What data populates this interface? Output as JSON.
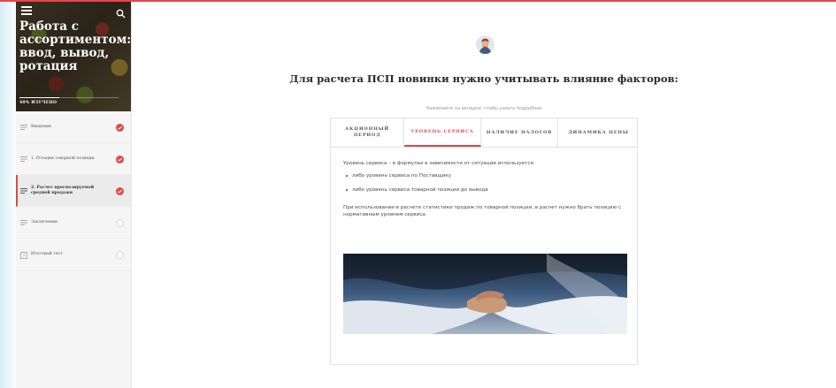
{
  "course": {
    "title": "Работа с ассортиментом: ввод, вывод, ротация",
    "progress_label": "40% ИЗУЧЕНО",
    "progress_value": 0.4
  },
  "sidebar": {
    "items": [
      {
        "label": "Введение",
        "icon": "lesson-lines-icon",
        "status": "done"
      },
      {
        "label": "1. Ротация товарной позиции",
        "icon": "lesson-lines-icon",
        "status": "done"
      },
      {
        "label": "2. Расчет прогнозируемой средней продажи",
        "icon": "lesson-lines-icon",
        "status": "done",
        "active": true
      },
      {
        "label": "Заключение",
        "icon": "lesson-lines-icon",
        "status": "todo"
      },
      {
        "label": "Итоговый тест",
        "icon": "quiz-icon",
        "status": "todo"
      }
    ]
  },
  "main": {
    "headline": "Для расчета ПСП новинки нужно учитывать влияние факторов:",
    "hint": "Нажимайте на вкладки, чтобы узнать подробнее",
    "tabs": [
      {
        "label": "АКЦИОННЫЙ ПЕРИОД"
      },
      {
        "label": "УРОВЕНЬ СЕРВИСА",
        "active": true
      },
      {
        "label": "НАЛИЧИЕ НАЛОГОВ"
      },
      {
        "label": "ДИНАМИКА ЦЕНЫ"
      }
    ],
    "content": {
      "intro": "Уровень сервиса – в формулах в зависимости от ситуации используется:",
      "bullets": [
        "либо уровень сервиса по Поставщику",
        "либо уровень сервиса товарной позиции до вывода"
      ],
      "paragraph": "При использовании в расчете статистики продаж по товарной позиции, в расчет нужно брать позицию с нормативным уровнем сервиса."
    }
  },
  "colors": {
    "accent": "#e4464a",
    "sidebar_bg": "#f5f5f5",
    "text": "#333333"
  },
  "icons": {
    "menu": "hamburger-menu-icon",
    "search": "search-icon",
    "avatar": "author-avatar-icon",
    "done": "completed-check-icon",
    "todo": "not-started-circle-icon"
  },
  "image": {
    "subject": "handshake-photo"
  }
}
